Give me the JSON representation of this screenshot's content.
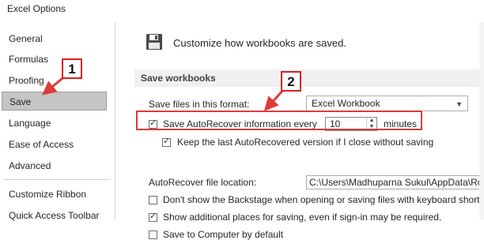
{
  "window": {
    "title": "Excel Options"
  },
  "sidebar": {
    "items": [
      {
        "label": "General"
      },
      {
        "label": "Formulas"
      },
      {
        "label": "Proofing"
      },
      {
        "label": "Save"
      },
      {
        "label": "Language"
      },
      {
        "label": "Ease of Access"
      },
      {
        "label": "Advanced"
      },
      {
        "label": "Customize Ribbon"
      },
      {
        "label": "Quick Access Toolbar"
      }
    ],
    "selected": "Save"
  },
  "main": {
    "header": "Customize how workbooks are saved.",
    "section_title": "Save workbooks",
    "save_format": {
      "label": "Save files in this format:",
      "value": "Excel Workbook"
    },
    "autorecover": {
      "label": "Save AutoRecover information every",
      "value": "10",
      "unit": "minutes",
      "checked": true
    },
    "keep_last": {
      "label": "Keep the last AutoRecovered version if I close without saving",
      "checked": true
    },
    "autorecover_location": {
      "label": "AutoRecover file location:",
      "value": "C:\\Users\\Madhuparna Sukul\\AppData\\Roa"
    },
    "dont_show_backstage": {
      "label": "Don't show the Backstage when opening or saving files with keyboard shortcu",
      "checked": false
    },
    "show_additional": {
      "label": "Show additional places for saving, even if sign-in may be required.",
      "checked": true
    },
    "save_to_computer": {
      "label": "Save to Computer by default",
      "checked": false
    }
  },
  "callouts": {
    "one": "1",
    "two": "2"
  },
  "colors": {
    "annotation_red": "#e03a3a",
    "selected_bg": "#c5c5c5"
  }
}
